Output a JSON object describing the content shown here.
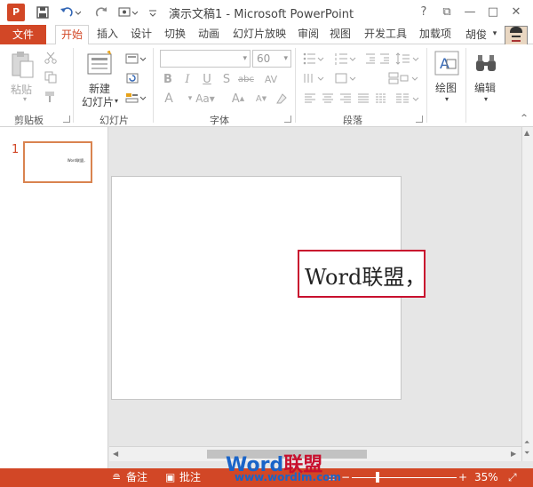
{
  "titlebar": {
    "app_logo": "P",
    "title": "演示文稿1 - Microsoft PowerPoint",
    "controls": [
      "?",
      "⧉",
      "—",
      "□",
      "✕"
    ]
  },
  "qat": {
    "icons": [
      "save-icon",
      "undo-icon",
      "redo-icon",
      "customize-icon"
    ]
  },
  "tabs": {
    "file": "文件",
    "items": [
      "开始",
      "插入",
      "设计",
      "切换",
      "动画",
      "幻灯片放映",
      "审阅",
      "视图",
      "开发工具",
      "加载项"
    ],
    "active": "开始",
    "user": "胡俊"
  },
  "ribbon": {
    "clipboard": {
      "paste": "粘贴",
      "label": "剪贴板"
    },
    "slides": {
      "new_slide_line1": "新建",
      "new_slide_line2": "幻灯片",
      "label": "幻灯片"
    },
    "font": {
      "font_name": "",
      "font_size": "60",
      "bold": "B",
      "italic": "I",
      "underline": "U",
      "strike": "S",
      "abc": "abc",
      "spacing": "AV",
      "label": "字体"
    },
    "paragraph": {
      "label": "段落"
    },
    "drawing": {
      "label": "绘图"
    },
    "editing": {
      "label": "编辑"
    }
  },
  "thumbnails": {
    "slide_number": "1",
    "thumb_text": "Word联盟，"
  },
  "slide": {
    "textbox": "Word联盟，"
  },
  "statusbar": {
    "notes": "备注",
    "comments": "批注",
    "zoom": "35%"
  },
  "watermark": {
    "brand_word": "Word",
    "brand_lm": "联盟",
    "url": "www.wordlm.com"
  },
  "colors": {
    "accent": "#d24726",
    "selection": "#c8102e"
  }
}
